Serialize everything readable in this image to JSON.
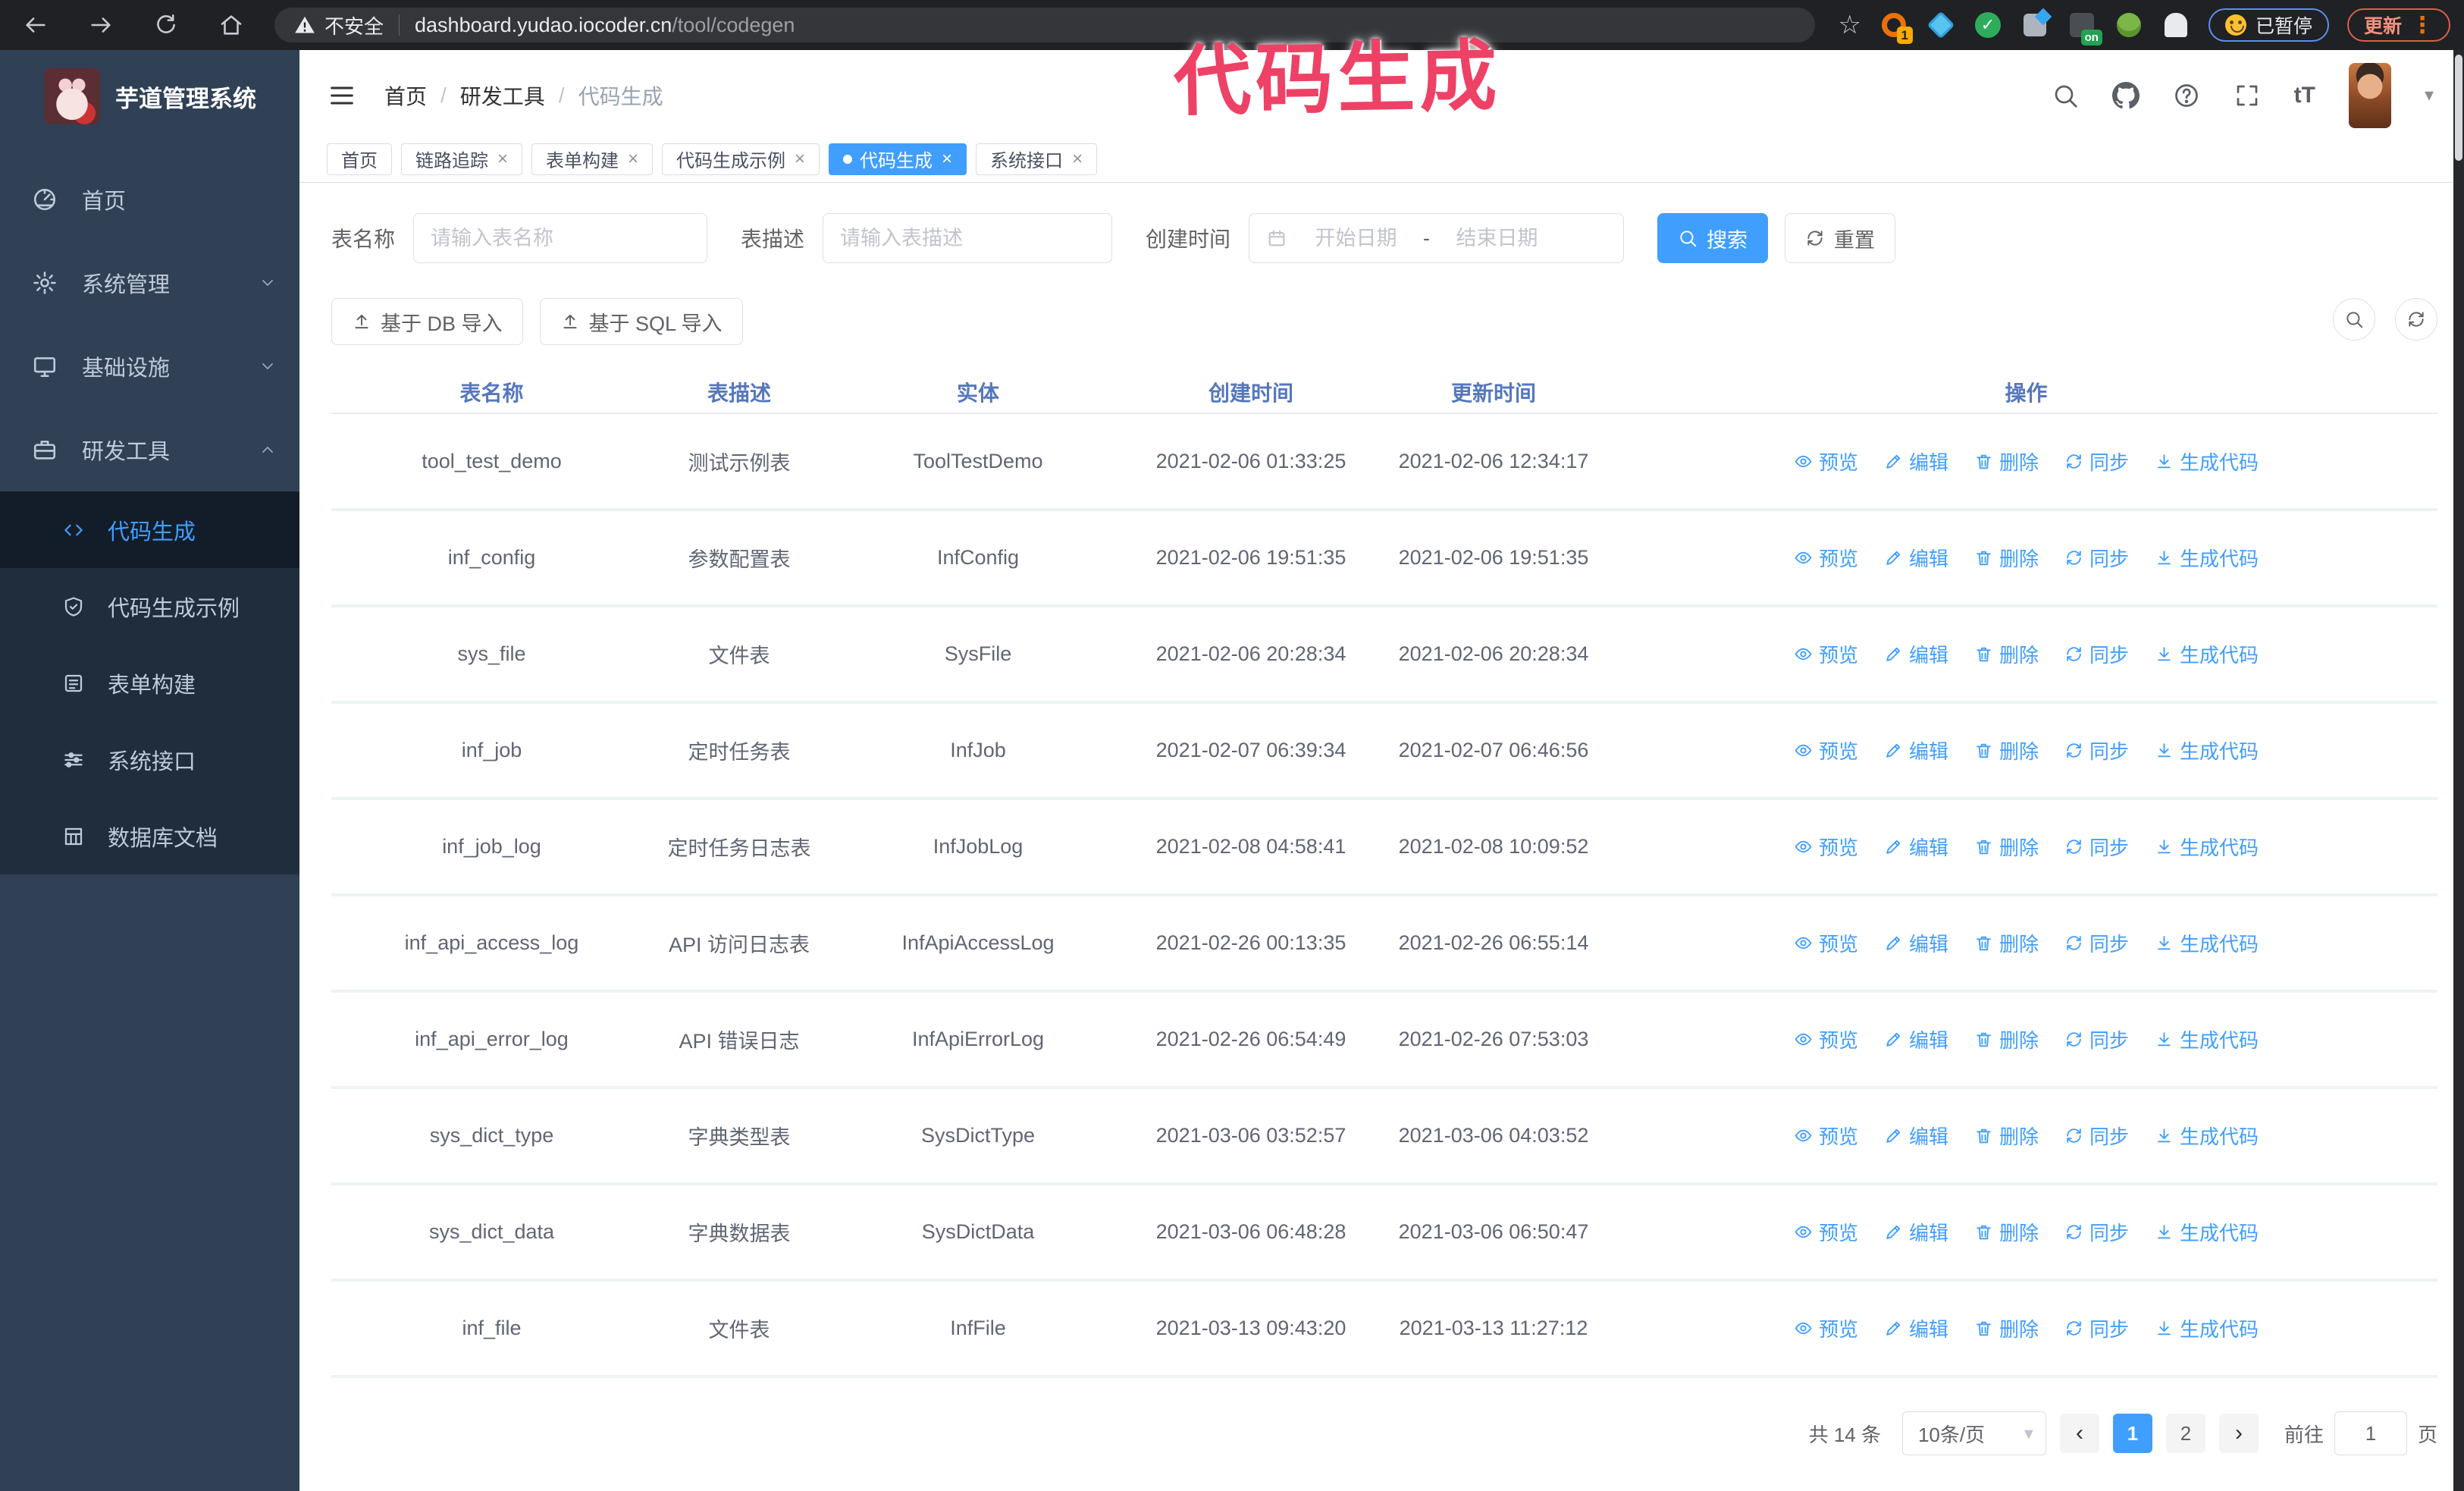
{
  "browser": {
    "security_label": "不安全",
    "url_host": "dashboard.yudao.iocoder.cn",
    "url_path": "/tool/codegen",
    "ext_badge": "1",
    "ext_on_badge": "on",
    "paused_label": "已暂停",
    "update_label": "更新"
  },
  "glyphs": {
    "star": "☆",
    "dots_vertical": "⋮",
    "close": "×",
    "caret_down": "▾",
    "chevron_left": "‹",
    "chevron_right": "›",
    "question": "?",
    "font_size": "tT"
  },
  "annotation": {
    "text": "代码生成"
  },
  "sidebar": {
    "app_title": "芋道管理系统",
    "items": [
      {
        "label": "首页"
      },
      {
        "label": "系统管理"
      },
      {
        "label": "基础设施"
      },
      {
        "label": "研发工具"
      }
    ],
    "submenu": [
      {
        "label": "代码生成"
      },
      {
        "label": "代码生成示例"
      },
      {
        "label": "表单构建"
      },
      {
        "label": "系统接口"
      },
      {
        "label": "数据库文档"
      }
    ]
  },
  "header": {
    "breadcrumb": [
      "首页",
      "研发工具",
      "代码生成"
    ],
    "separator": "/"
  },
  "tabs": [
    {
      "label": "首页"
    },
    {
      "label": "链路追踪"
    },
    {
      "label": "表单构建"
    },
    {
      "label": "代码生成示例"
    },
    {
      "label": "代码生成"
    },
    {
      "label": "系统接口"
    }
  ],
  "search_form": {
    "table_name_label": "表名称",
    "table_name_placeholder": "请输入表名称",
    "table_desc_label": "表描述",
    "table_desc_placeholder": "请输入表描述",
    "create_time_label": "创建时间",
    "start_date_placeholder": "开始日期",
    "range_separator": "-",
    "end_date_placeholder": "结束日期",
    "search_label": "搜索",
    "reset_label": "重置"
  },
  "toolbar": {
    "db_import_label": "基于 DB 导入",
    "sql_import_label": "基于 SQL 导入"
  },
  "table": {
    "columns": [
      "表名称",
      "表描述",
      "实体",
      "创建时间",
      "更新时间",
      "操作"
    ],
    "actions": [
      "预览",
      "编辑",
      "删除",
      "同步",
      "生成代码"
    ],
    "rows": [
      {
        "name": "tool_test_demo",
        "desc": "测试示例表",
        "entity": "ToolTestDemo",
        "created": "2021-02-06 01:33:25",
        "updated": "2021-02-06 12:34:17"
      },
      {
        "name": "inf_config",
        "desc": "参数配置表",
        "entity": "InfConfig",
        "created": "2021-02-06 19:51:35",
        "updated": "2021-02-06 19:51:35"
      },
      {
        "name": "sys_file",
        "desc": "文件表",
        "entity": "SysFile",
        "created": "2021-02-06 20:28:34",
        "updated": "2021-02-06 20:28:34"
      },
      {
        "name": "inf_job",
        "desc": "定时任务表",
        "entity": "InfJob",
        "created": "2021-02-07 06:39:34",
        "updated": "2021-02-07 06:46:56"
      },
      {
        "name": "inf_job_log",
        "desc": "定时任务日志表",
        "entity": "InfJobLog",
        "created": "2021-02-08 04:58:41",
        "updated": "2021-02-08 10:09:52"
      },
      {
        "name": "inf_api_access_log",
        "desc": "API 访问日志表",
        "entity": "InfApiAccessLog",
        "created": "2021-02-26 00:13:35",
        "updated": "2021-02-26 06:55:14"
      },
      {
        "name": "inf_api_error_log",
        "desc": "API 错误日志",
        "entity": "InfApiErrorLog",
        "created": "2021-02-26 06:54:49",
        "updated": "2021-02-26 07:53:03"
      },
      {
        "name": "sys_dict_type",
        "desc": "字典类型表",
        "entity": "SysDictType",
        "created": "2021-03-06 03:52:57",
        "updated": "2021-03-06 04:03:52"
      },
      {
        "name": "sys_dict_data",
        "desc": "字典数据表",
        "entity": "SysDictData",
        "created": "2021-03-06 06:48:28",
        "updated": "2021-03-06 06:50:47"
      },
      {
        "name": "inf_file",
        "desc": "文件表",
        "entity": "InfFile",
        "created": "2021-03-13 09:43:20",
        "updated": "2021-03-13 11:27:12"
      }
    ]
  },
  "pagination": {
    "total_label": "共 14 条",
    "page_size": "10条/页",
    "page_1": "1",
    "page_2": "2",
    "goto_label": "前往",
    "goto_value": "1",
    "page_label": "页"
  },
  "colors": {
    "accent": "#409eff",
    "annotation": "#ee4166",
    "sidebar_bg": "#304156",
    "submenu_bg": "#1f2d3d",
    "chrome_bg": "#202124",
    "header_text": "#5577bd"
  }
}
